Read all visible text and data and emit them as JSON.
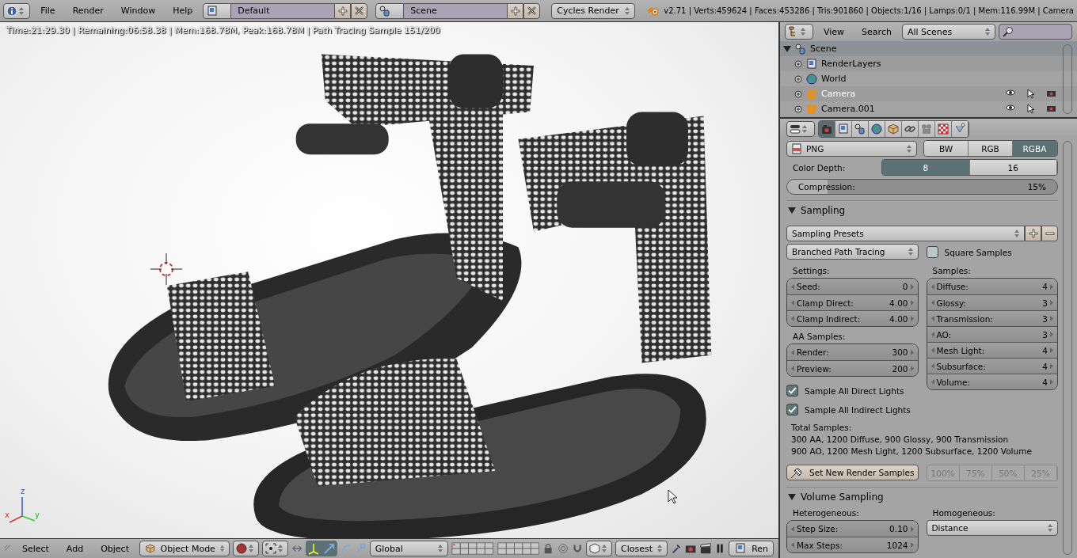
{
  "menubar": {
    "menus": [
      "File",
      "Render",
      "Window",
      "Help"
    ],
    "layout": "Default",
    "scene": "Scene",
    "engine": "Cycles Render",
    "stats": "v2.71 | Verts:459624 | Faces:453286 | Tris:901860 | Objects:1/16 | Lamps:0/1 | Mem:116.99M | Camera"
  },
  "viewport": {
    "render_info": "Time:21:29.30 | Remaining:06:58.38 | Mem:168.78M, Peak:168.78M | Path Tracing Sample 151/200",
    "axes": [
      "x",
      "y",
      "z"
    ]
  },
  "viewport_header": {
    "menus": [
      "Select",
      "Add",
      "Object"
    ],
    "mode": "Object Mode",
    "orientation": "Global",
    "snap_target": "Closest",
    "render_button": "Ren"
  },
  "outliner": {
    "menus": [
      "View",
      "Search"
    ],
    "display": "All Scenes",
    "tree": [
      {
        "name": "Scene",
        "kind": "scene",
        "selected": true,
        "active": false,
        "children": [
          {
            "name": "RenderLayers",
            "kind": "renderlayers",
            "selected": false,
            "active": false
          },
          {
            "name": "World",
            "kind": "world",
            "selected": false,
            "active": false
          },
          {
            "name": "Camera",
            "kind": "camera",
            "selected": false,
            "active": true
          },
          {
            "name": "Camera.001",
            "kind": "camera",
            "selected": false,
            "active": false
          }
        ]
      }
    ]
  },
  "properties": {
    "tabs": [
      {
        "kind": "render",
        "selected": true
      },
      {
        "kind": "layers",
        "selected": false
      },
      {
        "kind": "scene",
        "selected": false
      },
      {
        "kind": "world",
        "selected": false
      },
      {
        "kind": "object",
        "selected": false
      },
      {
        "kind": "constraints",
        "selected": false
      },
      {
        "kind": "camera",
        "selected": false
      },
      {
        "kind": "texture",
        "selected": false
      },
      {
        "kind": "particles",
        "selected": false
      }
    ],
    "file_format": "PNG",
    "color_modes": [
      {
        "label": "BW",
        "selected": false
      },
      {
        "label": "RGB",
        "selected": false
      },
      {
        "label": "RGBA",
        "selected": true
      }
    ],
    "color_depth": {
      "label": "Color Depth:",
      "options": [
        {
          "label": "8",
          "selected": true
        },
        {
          "label": "16",
          "selected": false
        }
      ]
    },
    "compression": {
      "label": "Compression:",
      "value": "15%",
      "level": 0.15
    },
    "sampling": {
      "title": "Sampling",
      "expanded": true,
      "presets": "Sampling Presets",
      "integrator": "Branched Path Tracing",
      "square_samples": {
        "label": "Square Samples",
        "checked": false
      },
      "settings_label": "Settings:",
      "settings": [
        {
          "label": "Seed:",
          "value": "0"
        },
        {
          "label": "Clamp Direct:",
          "value": "4.00"
        },
        {
          "label": "Clamp Indirect:",
          "value": "4.00"
        }
      ],
      "aa_label": "AA Samples:",
      "aa": [
        {
          "label": "Render:",
          "value": "300"
        },
        {
          "label": "Preview:",
          "value": "200"
        }
      ],
      "samples_label": "Samples:",
      "samples": [
        {
          "label": "Diffuse:",
          "value": "4"
        },
        {
          "label": "Glossy:",
          "value": "3"
        },
        {
          "label": "Transmission:",
          "value": "3"
        },
        {
          "label": "AO:",
          "value": "3"
        },
        {
          "label": "Mesh Light:",
          "value": "4"
        },
        {
          "label": "Subsurface:",
          "value": "4"
        },
        {
          "label": "Volume:",
          "value": "4"
        }
      ],
      "checkboxes": [
        {
          "label": "Sample All Direct Lights",
          "checked": true
        },
        {
          "label": "Sample All Indirect Lights",
          "checked": true
        }
      ],
      "total_label": "Total Samples:",
      "total_lines": [
        "300 AA, 1200 Diffuse, 900 Glossy, 900 Transmission",
        "900 AO, 1200 Mesh Light, 1200 Subsurface, 1200 Volume"
      ],
      "set_button": "Set New Render Samples",
      "percents": [
        {
          "label": "100%",
          "disabled": true
        },
        {
          "label": "75%",
          "disabled": true
        },
        {
          "label": "50%",
          "disabled": true
        },
        {
          "label": "25%",
          "disabled": true
        }
      ]
    },
    "volume_sampling": {
      "title": "Volume Sampling",
      "expanded": true,
      "heterogeneous_label": "Heterogeneous:",
      "heterogeneous": [
        {
          "label": "Step Size:",
          "value": "0.10"
        },
        {
          "label": "Max Steps:",
          "value": "1024"
        }
      ],
      "homogeneous_label": "Homogeneous:",
      "homogeneous": "Distance"
    }
  }
}
